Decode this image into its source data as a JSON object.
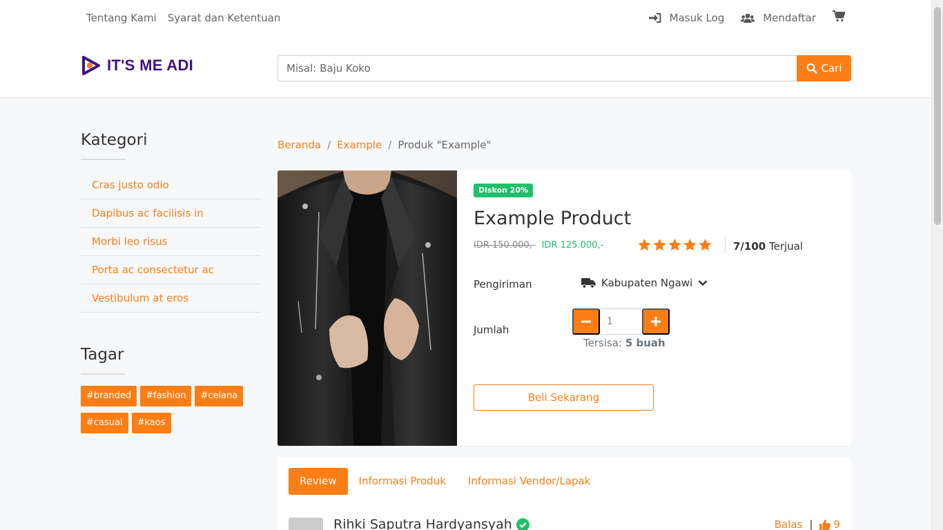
{
  "topnav": {
    "links_left": [
      "Tentang Kami",
      "Syarat dan Ketentuan"
    ],
    "login_label": "Masuk Log",
    "register_label": "Mendaftar"
  },
  "brand": {
    "name": "IT'S ME ADI",
    "color": "#3c1280"
  },
  "search": {
    "placeholder": "Misal: Baju Koko",
    "button_label": "Cari"
  },
  "sidebar": {
    "category_title": "Kategori",
    "categories": [
      "Cras justo odio",
      "Dapibus ac facilisis in",
      "Morbi leo risus",
      "Porta ac consectetur ac",
      "Vestibulum at eros"
    ],
    "tag_title": "Tagar",
    "tags": [
      "#branded",
      "#fashion",
      "#celana",
      "#casual",
      "#kaos"
    ]
  },
  "breadcrumb": {
    "home": "Beranda",
    "category": "Example",
    "current": "Produk \"Example\"",
    "separator": "/"
  },
  "product": {
    "discount_badge": "Diskon 20%",
    "title": "Example Product",
    "old_price": "IDR 150.000,-",
    "new_price": "IDR 125.000,-",
    "rating": 5,
    "sold_count": "7/100",
    "sold_label": "Terjual",
    "shipping_label": "Pengiriman",
    "shipping_location": "Kabupaten Ngawi",
    "qty_label": "Jumlah",
    "qty_value": "1",
    "stock_label": "Tersisa:",
    "stock_value": "5 buah",
    "buy_label": "Beli Sekarang"
  },
  "tabs": [
    "Review",
    "Informasi Produk",
    "Informasi Vendor/Lapak"
  ],
  "review": {
    "name": "Rihki Saputra Hardyansyah",
    "reply_label": "Balas",
    "separator": "|",
    "likes": "9"
  },
  "colors": {
    "accent": "#fd7e14",
    "success": "#20c06a",
    "brand": "#3c1280"
  }
}
